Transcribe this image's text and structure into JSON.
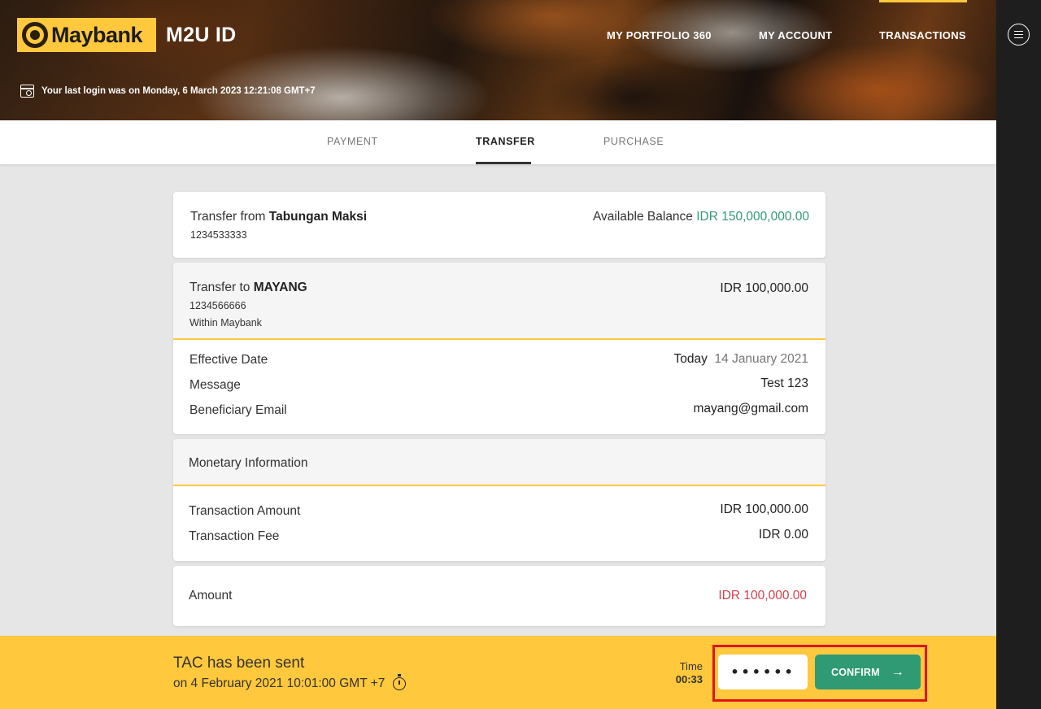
{
  "header": {
    "logo_text": "Maybank",
    "app_title": "M2U ID",
    "nav": {
      "portfolio": "MY PORTFOLIO 360",
      "account": "MY ACCOUNT",
      "transactions": "TRANSACTIONS"
    },
    "last_login": "Your last login was on Monday, 6 March 2023 12:21:08 GMT+7"
  },
  "tabs": {
    "payment": "PAYMENT",
    "transfer": "TRANSFER",
    "purchase": "PURCHASE",
    "active": "TRANSFER"
  },
  "from": {
    "prefix": "Transfer from",
    "account_name": "Tabungan Maksi",
    "account_number": "1234533333",
    "balance_label": "Available Balance",
    "balance_value": "IDR 150,000,000.00"
  },
  "to": {
    "prefix": "Transfer to",
    "name": "MAYANG",
    "account_number": "1234566666",
    "bank": "Within Maybank",
    "amount": "IDR 100,000.00",
    "effective_date_label": "Effective Date",
    "effective_date_day": "Today",
    "effective_date_value": "14 January 2021",
    "message_label": "Message",
    "message_value": "Test 123",
    "email_label": "Beneficiary Email",
    "email_value": "mayang@gmail.com"
  },
  "monetary": {
    "title": "Monetary Information",
    "amount_label": "Transaction Amount",
    "amount_value": "IDR 100,000.00",
    "fee_label": "Transaction Fee",
    "fee_value": "IDR 0.00"
  },
  "total": {
    "label": "Amount",
    "value": "IDR 100,000.00"
  },
  "tac": {
    "title": "TAC has been sent",
    "sent_on": "on 4 February 2021 10:01:00 GMT +7",
    "time_label": "Time",
    "time_value": "00:33",
    "input_value": "••••••",
    "confirm_label": "CONFIRM"
  },
  "colors": {
    "brand_yellow": "#ffc83d",
    "confirm_green": "#2f9a73",
    "amount_red": "#d6404b",
    "highlight_red": "#e0151c"
  }
}
